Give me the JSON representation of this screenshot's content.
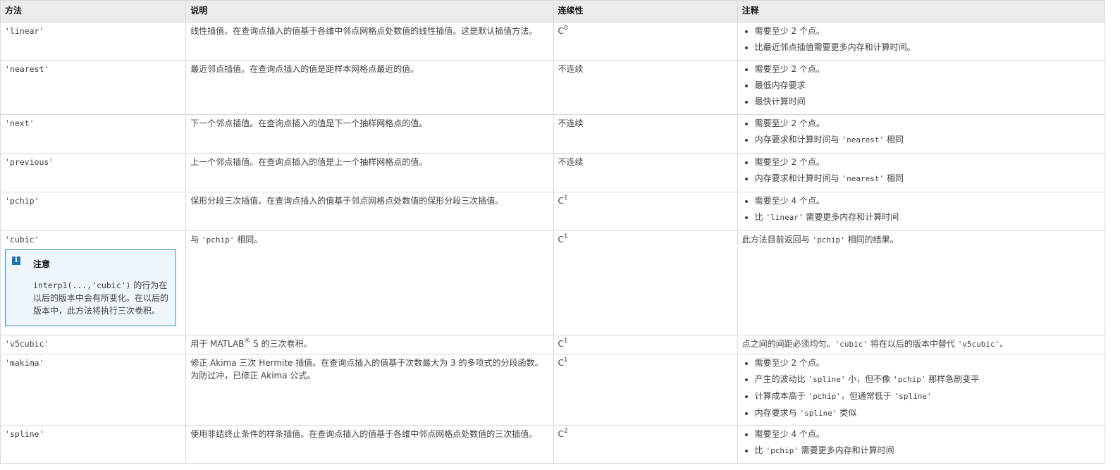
{
  "headers": {
    "method": "方法",
    "description": "说明",
    "continuity": "连续性",
    "notes": "注释"
  },
  "rows": [
    {
      "method": "'linear'",
      "description": "线性插值。在查询点插入的值基于各维中邻点网格点处数值的线性插值。这是默认插值方法。",
      "continuity": {
        "base": "C",
        "sup": "0"
      },
      "notes": [
        "需要至少 2 个点。",
        "比最近邻点插值需要更多内存和计算时间。"
      ]
    },
    {
      "method": "'nearest'",
      "description": "最近邻点插值。在查询点插入的值是距样本网格点最近的值。",
      "continuity": {
        "text": "不连续"
      },
      "notes": [
        "需要至少 2 个点。",
        "最低内存要求",
        "最快计算时间"
      ]
    },
    {
      "method": "'next'",
      "description": "下一个邻点插值。在查询点插入的值是下一个抽样网格点的值。",
      "continuity": {
        "text": "不连续"
      },
      "notes": [
        "需要至少 2 个点。",
        {
          "pre": "内存要求和计算时间与 ",
          "code": "'nearest'",
          "post": " 相同"
        }
      ]
    },
    {
      "method": "'previous'",
      "description": "上一个邻点插值。在查询点插入的值是上一个抽样网格点的值。",
      "continuity": {
        "text": "不连续"
      },
      "notes": [
        "需要至少 2 个点。",
        {
          "pre": "内存要求和计算时间与 ",
          "code": "'nearest'",
          "post": " 相同"
        }
      ]
    },
    {
      "method": "'pchip'",
      "description": "保形分段三次插值。在查询点插入的值基于邻点网格点处数值的保形分段三次插值。",
      "continuity": {
        "base": "C",
        "sup": "1"
      },
      "notes": [
        "需要至少 4 个点。",
        {
          "pre": "比 ",
          "code": "'linear'",
          "post": " 需要更多内存和计算时间"
        }
      ]
    },
    {
      "method": "'cubic'",
      "description_pre": "与 ",
      "description_code": "'pchip'",
      "description_post": " 相同。",
      "note_box": {
        "title": "注意",
        "code": "interp1(...,'cubic')",
        "text": " 的行为在以后的版本中会有所变化。在以后的版本中，此方法将执行三次卷积。"
      },
      "continuity": {
        "base": "C",
        "sup": "1"
      },
      "notes_pre": "此方法目前返回与 ",
      "notes_code": "'pchip'",
      "notes_post": " 相同的结果。"
    },
    {
      "method": "'v5cubic'",
      "description_pre": "用于 MATLAB",
      "description_sup": "®",
      "description_post": " 5 的三次卷积。",
      "continuity": {
        "base": "C",
        "sup": "1"
      },
      "notes_pre": "点之间的间距必须均匀。",
      "notes_code1": "'cubic'",
      "notes_mid": " 将在以后的版本中替代 ",
      "notes_code2": "'v5cubic'",
      "notes_post": "。"
    },
    {
      "method": "'makima'",
      "description": "修正 Akima 三次 Hermite 插值。在查询点插入的值基于次数最大为 3 的多项式的分段函数。为防过冲，已修正 Akima 公式。",
      "continuity": {
        "base": "C",
        "sup": "1"
      },
      "notes": [
        "需要至少 2 个点。",
        {
          "pre": "产生的波动比 ",
          "code": "'spline'",
          "post": " 小，但不像 ",
          "code2": "'pchip'",
          "post2": " 那样急剧变平"
        },
        {
          "pre": "计算成本高于 ",
          "code": "'pchip'",
          "post": "，但通常低于 ",
          "code2": "'spline'",
          "post2": ""
        },
        {
          "pre": "内存要求与 ",
          "code": "'spline'",
          "post": " 类似"
        }
      ]
    },
    {
      "method": "'spline'",
      "description": "使用非结终止条件的样条插值。在查询点插入的值基于各维中邻点网格点处数值的三次插值。",
      "continuity": {
        "base": "C",
        "sup": "2"
      },
      "notes": [
        "需要至少 4 个点。",
        {
          "pre": "比 ",
          "code": "'pchip'",
          "post": " 需要更多内存和计算时间"
        }
      ]
    }
  ]
}
